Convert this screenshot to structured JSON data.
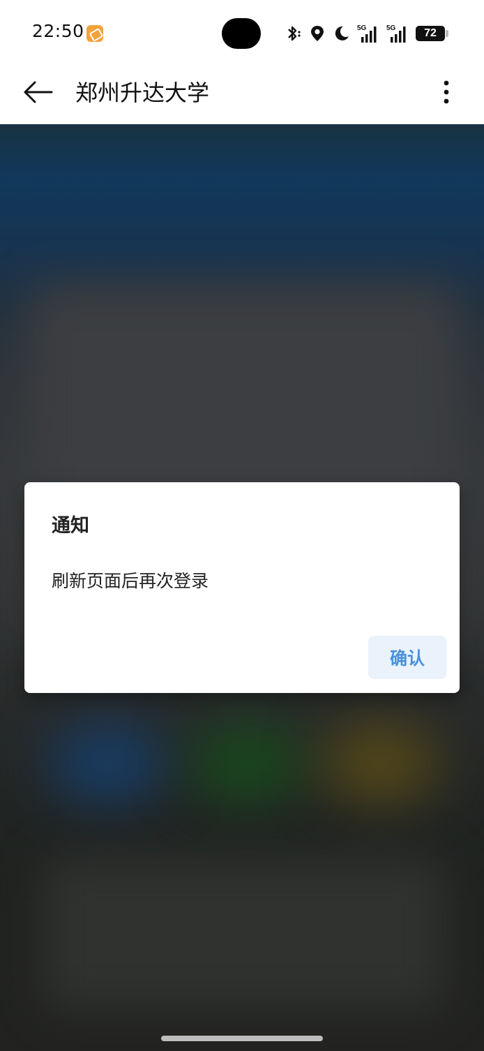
{
  "status_bar": {
    "time": "22:50",
    "notification_icon": "app-badge-icon",
    "icons": [
      "bluetooth-icon",
      "location-icon",
      "moon-icon",
      "signal-5g-icon",
      "signal-5g-icon"
    ],
    "signal_label_1": "5G",
    "signal_label_2": "5G",
    "battery_level": "72"
  },
  "app_bar": {
    "back_icon": "back-arrow-icon",
    "title": "郑州升达大学",
    "menu_icon": "more-vertical-icon"
  },
  "dialog": {
    "title": "通知",
    "message": "刷新页面后再次登录",
    "confirm_label": "确认"
  },
  "colors": {
    "accent": "#4a90d9",
    "confirm_bg": "#eaf2fc",
    "badge": "#f4a23a"
  }
}
